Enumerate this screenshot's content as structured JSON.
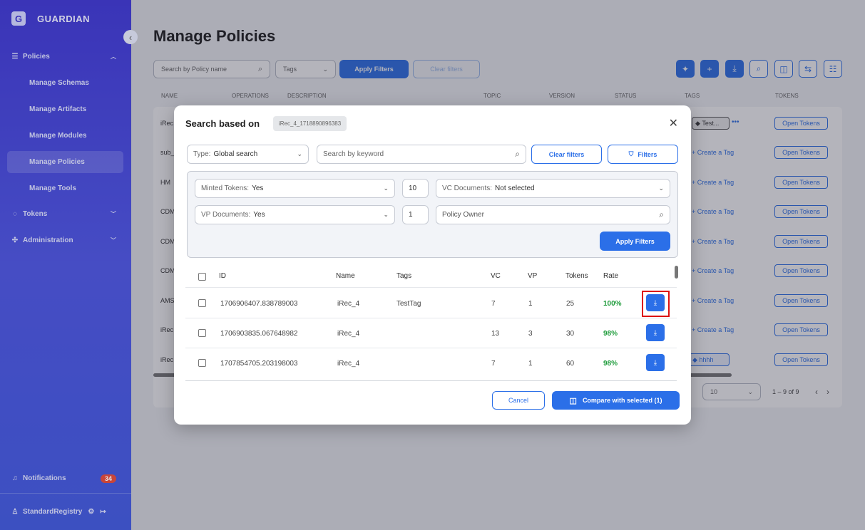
{
  "app": {
    "name": "GUARDIAN",
    "logo_letter": "G"
  },
  "sidebar": {
    "items": [
      {
        "label": "Policies",
        "icon": "list-icon"
      },
      {
        "label": "Manage Schemas"
      },
      {
        "label": "Manage Artifacts"
      },
      {
        "label": "Manage Modules"
      },
      {
        "label": "Manage Policies"
      },
      {
        "label": "Manage Tools"
      },
      {
        "label": "Tokens",
        "icon": "tokens-icon"
      },
      {
        "label": "Administration",
        "icon": "admin-icon"
      }
    ],
    "notifications_label": "Notifications",
    "notifications_count": "34",
    "user_label": "StandardRegistry"
  },
  "page": {
    "title": "Manage Policies",
    "search_placeholder": "Search by Policy name",
    "tags_label": "Tags",
    "apply_filters": "Apply Filters",
    "clear_filters": "Clear filters",
    "columns": [
      "NAME",
      "OPERATIONS",
      "DESCRIPTION",
      "TOPIC",
      "VERSION",
      "STATUS",
      "TAGS",
      "TOKENS"
    ],
    "row_names": [
      "iRec",
      "sub_",
      "HM",
      "CDM",
      "CDM",
      "CDM",
      "AMS",
      "iRec",
      "iRec"
    ],
    "tag_chip_1": "Test...",
    "tag_chip_2": "hhhh",
    "create_tag": "+ Create a Tag",
    "open_tokens": "Open Tokens",
    "page_size": "10",
    "pagination": "1 – 9 of 9"
  },
  "modal": {
    "title": "Search based on",
    "chip": "iRec_4_1718890896383",
    "type_label": "Type:",
    "type_value": "Global search",
    "keyword_placeholder": "Search by keyword",
    "clear_filters": "Clear filters",
    "filters": "Filters",
    "minted_label": "Minted Tokens:",
    "minted_value": "Yes",
    "minted_count": "10",
    "vc_label": "VC Documents:",
    "vc_value": "Not selected",
    "vp_label": "VP Documents:",
    "vp_value": "Yes",
    "vp_count": "1",
    "owner_placeholder": "Policy Owner",
    "apply_filters": "Apply Filters",
    "columns": {
      "id": "ID",
      "name": "Name",
      "tags": "Tags",
      "vc": "VC",
      "vp": "VP",
      "tokens": "Tokens",
      "rate": "Rate"
    },
    "rows": [
      {
        "id": "1706906407.838789003",
        "name": "iRec_4",
        "tags": "TestTag",
        "vc": "7",
        "vp": "1",
        "tokens": "25",
        "rate": "100%"
      },
      {
        "id": "1706903835.067648982",
        "name": "iRec_4",
        "tags": "",
        "vc": "13",
        "vp": "3",
        "tokens": "30",
        "rate": "98%"
      },
      {
        "id": "1707854705.203198003",
        "name": "iRec_4",
        "tags": "",
        "vc": "7",
        "vp": "1",
        "tokens": "60",
        "rate": "98%"
      }
    ],
    "cancel": "Cancel",
    "compare": "Compare with selected (1)"
  },
  "colors": {
    "accent": "#2b6fe8",
    "sidebar": "#3d36c9",
    "rate_green": "#1d9b3a",
    "highlight": "#dd1111"
  }
}
